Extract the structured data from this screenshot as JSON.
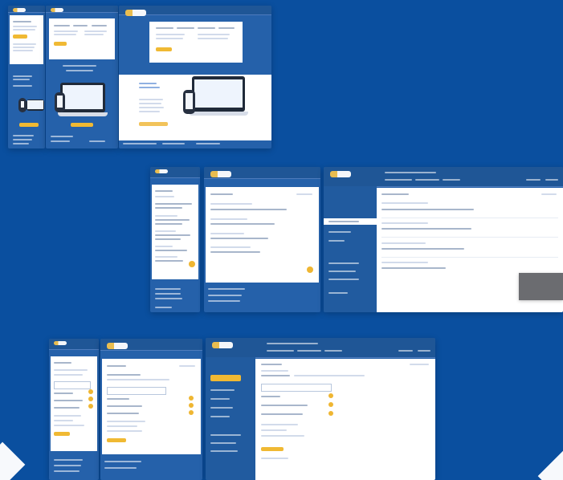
{
  "colors": {
    "background": "#0a4f9f",
    "panel": "#2561aa",
    "accent": "#f0b933",
    "content": "#ffffff"
  },
  "screenshots": {
    "top": [
      "mobile",
      "tablet",
      "desktop"
    ],
    "middle": [
      "mobile",
      "tablet",
      "desktop"
    ],
    "bottom": [
      "mobile",
      "desktop"
    ]
  }
}
